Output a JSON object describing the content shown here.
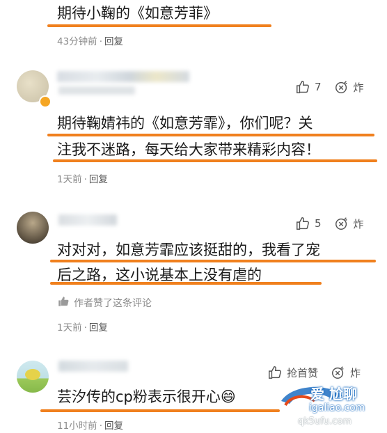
{
  "comments": [
    {
      "text": [
        "期待小鞠的《如意芳菲》"
      ],
      "time": "43分钟前",
      "reply": "回复"
    },
    {
      "text": [
        "期待鞠婧祎的《如意芳霏》，你们呢？关",
        "注我不迷路，每天给大家带来精彩内容！"
      ],
      "likes": "7",
      "share": "炸",
      "time": "1天前",
      "reply": "回复"
    },
    {
      "text": [
        "对对对，如意芳霏应该挺甜的，我看了宠",
        "后之路，这小说基本上没有虐的"
      ],
      "likes": "5",
      "share": "炸",
      "author_liked": "作者赞了这条评论",
      "time": "1天前",
      "reply": "回复"
    },
    {
      "text": [
        "芸汐传的cp粉表示很开心😄"
      ],
      "likes": "抢首赞",
      "share": "炸",
      "time": "11小时前",
      "reply": "回复"
    }
  ],
  "watermark": {
    "line1": "爱 尬聊",
    "line2": "igaliao.com",
    "line3": "qk5ufu.com"
  },
  "colors": {
    "underline": "#f0801e",
    "meta": "#8a8a8a",
    "vip_badge": "#f5a623"
  }
}
